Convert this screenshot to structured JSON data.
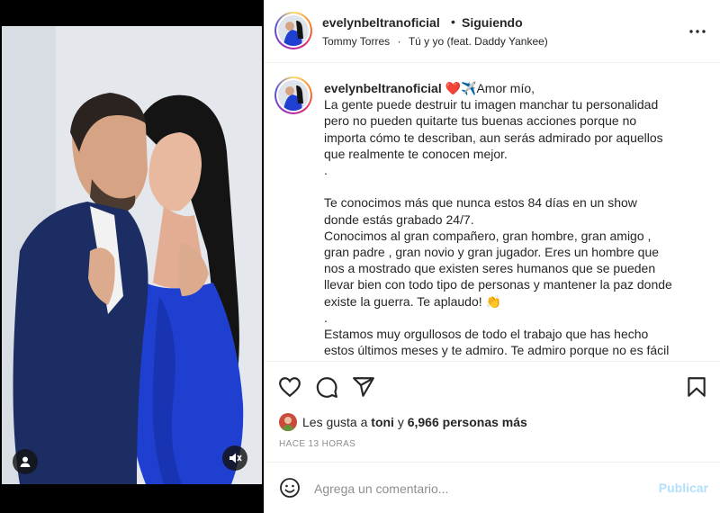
{
  "post": {
    "media_alt": "Pareja abrazada frente a frente",
    "header": {
      "username": "evelynbeltranoficial",
      "separator": "•",
      "follow_status": "Siguiendo",
      "music_artist": "Tommy Torres",
      "music_separator": "·",
      "music_title": "Tú y yo (feat. Daddy Yankee)",
      "more_icon": "more-horizontal-icon"
    },
    "caption": {
      "username": "evelynbeltranoficial",
      "lines": [
        " ❤️✈️Amor mío,",
        "La gente puede destruir tu imagen manchar tu personalidad",
        "pero no pueden quitarte tus buenas acciones porque no",
        "importa cómo te describan, aun serás admirado por aquellos",
        "que realmente te conocen mejor.",
        ".",
        "",
        "Te conocimos más que nunca estos 84 días en un show",
        "donde estás grabado 24/7.",
        "Conocimos al gran compañero, gran hombre, gran amigo ,",
        "gran padre , gran novio y gran jugador. Eres un hombre que",
        "nos a mostrado que existen seres humanos que se pueden",
        "llevar bien con todo tipo de personas y mantener la paz donde",
        "existe la guerra. Te aplaudo! 👏",
        ".",
        "Estamos muy orgullosos de todo el trabajo que has hecho",
        "estos últimos meses y te admiro. Te admiro porque no es fácil"
      ]
    },
    "actions": {
      "like_icon": "heart-icon",
      "comment_icon": "comment-icon",
      "share_icon": "share-icon",
      "save_icon": "bookmark-icon"
    },
    "likes": {
      "prefix": "Les gusta a",
      "user": "toni",
      "conjunction": "y",
      "count_text": "6,966 personas más"
    },
    "timestamp": "HACE 13 HORAS",
    "comment": {
      "emoji_icon": "emoji-icon",
      "placeholder": "Agrega un comentario...",
      "value": "",
      "publish_label": "Publicar"
    },
    "media_controls": {
      "tags_icon": "user-tag-icon",
      "mute_icon": "muted-speaker-icon"
    },
    "colors": {
      "accent_disabled": "#b2dffc",
      "text": "#262626",
      "secondary_text": "#8e8e8e",
      "border": "#efefef",
      "dress_blue": "#1f3fd0",
      "suit_navy": "#1b2d63"
    }
  }
}
